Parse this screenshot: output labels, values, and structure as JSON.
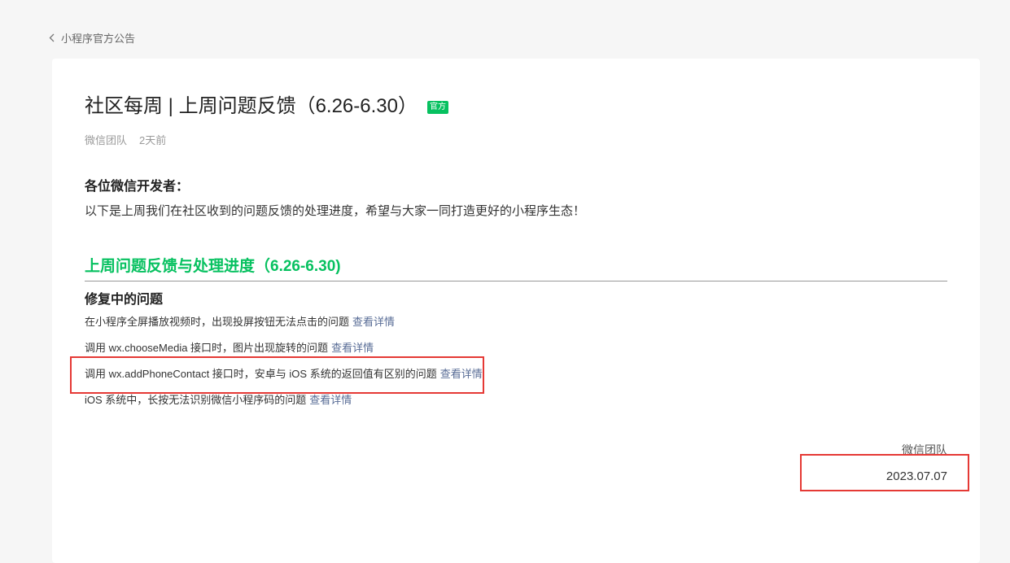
{
  "nav": {
    "back_label": "小程序官方公告"
  },
  "article": {
    "title": "社区每周 | 上周问题反馈（6.26-6.30）",
    "badge": "官方",
    "author": "微信团队",
    "time_ago": "2天前",
    "greeting": "各位微信开发者：",
    "intro": "以下是上周我们在社区收到的问题反馈的处理进度，希望与大家一同打造更好的小程序生态！",
    "section_heading": "上周问题反馈与处理进度（6.26-6.30)",
    "sub_heading": "修复中的问题",
    "issues": [
      {
        "text": "在小程序全屏播放视频时，出现投屏按钮无法点击的问题",
        "link": "查看详情"
      },
      {
        "text": "调用 wx.chooseMedia 接口时，图片出现旋转的问题",
        "link": "查看详情"
      },
      {
        "text": "调用 wx.addPhoneContact 接口时，安卓与 iOS 系统的返回值有区别的问题",
        "link": "查看详情"
      },
      {
        "text": "iOS 系统中，长按无法识别微信小程序码的问题",
        "link": "查看详情"
      }
    ],
    "signature": "微信团队",
    "date": "2023.07.07"
  },
  "colors": {
    "accent": "#07c160",
    "link": "#576b95",
    "highlight": "#e53935"
  }
}
